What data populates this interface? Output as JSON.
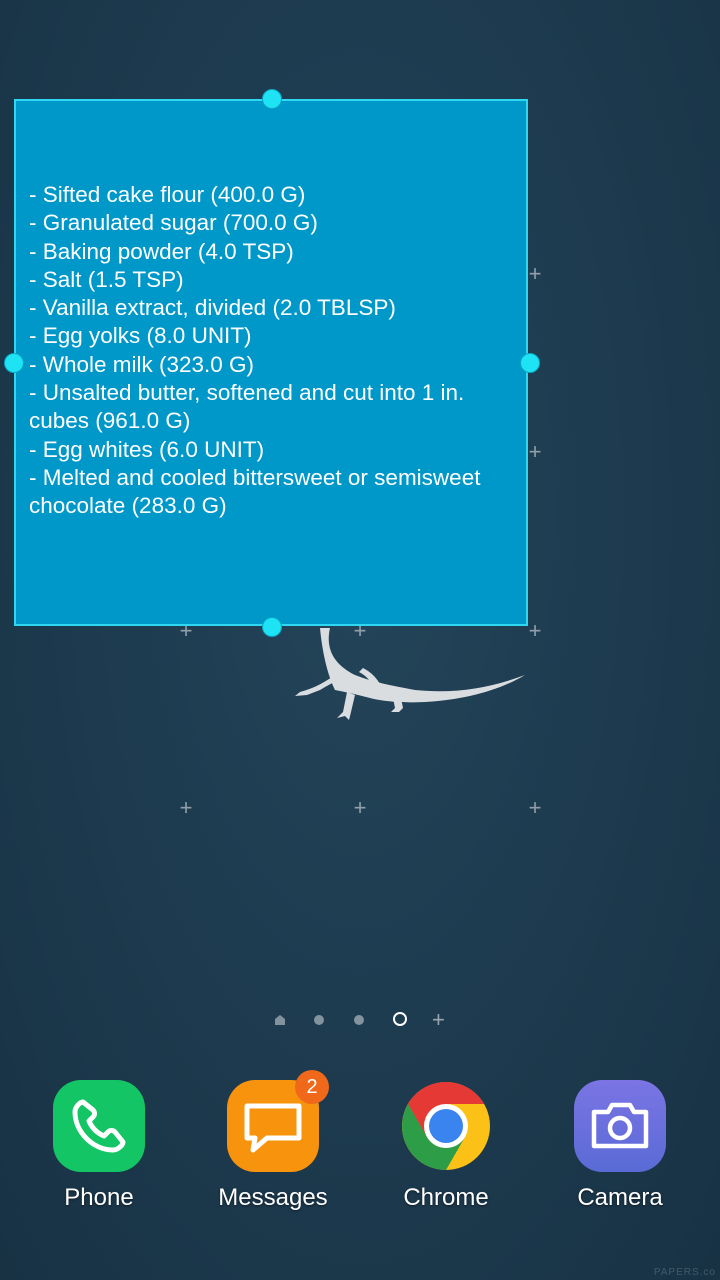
{
  "widget": {
    "lines": [
      "- Sifted cake flour (400.0 G)",
      "- Granulated sugar (700.0 G)",
      "- Baking powder (4.0 TSP)",
      "- Salt (1.5 TSP)",
      "- Vanilla extract, divided (2.0 TBLSP)",
      "- Egg yolks (8.0 UNIT)",
      "- Whole milk (323.0 G)",
      "- Unsalted butter, softened and cut into 1 in. cubes (961.0 G)",
      "- Egg whites (6.0 UNIT)",
      "- Melted and cooled bittersweet or semisweet chocolate (283.0 G)"
    ],
    "background_color": "#0097c9",
    "border_color": "#2fd8f2"
  },
  "home_grid": {
    "add_glyph": "+"
  },
  "page_indicator": {
    "pages": [
      "home-icon",
      "dot",
      "dot",
      "current-dot"
    ],
    "current_page": 4,
    "add_page_glyph": "+"
  },
  "dock": {
    "apps": [
      {
        "label": "Phone",
        "icon": "phone-icon",
        "color": "#13c565"
      },
      {
        "label": "Messages",
        "icon": "messages-icon",
        "color": "#f7930d",
        "badge": "2"
      },
      {
        "label": "Chrome",
        "icon": "chrome-icon",
        "color": "#ffffff"
      },
      {
        "label": "Camera",
        "icon": "camera-icon",
        "color": "#6a6fde"
      }
    ]
  },
  "wallpaper": {
    "watermark": "PAPERS.co"
  }
}
